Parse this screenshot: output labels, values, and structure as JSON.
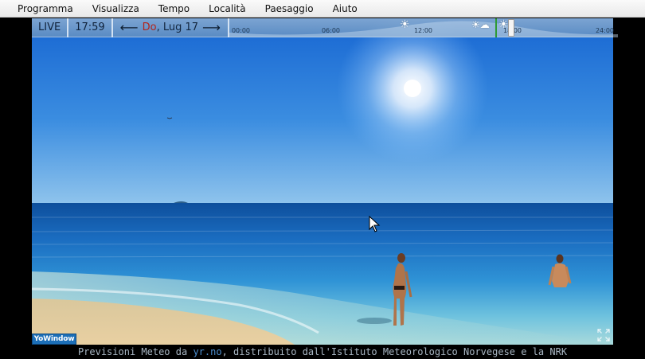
{
  "menu": {
    "items": [
      "Programma",
      "Visualizza",
      "Tempo",
      "Località",
      "Paesaggio",
      "Aiuto"
    ]
  },
  "toolbar": {
    "live_label": "LIVE",
    "time": "17:59",
    "prev_arrow": "⟵",
    "next_arrow": "⟶",
    "day_name": "Do",
    "date_rest": ", Lug 17",
    "day_color": "#b3241b"
  },
  "timeline": {
    "ticks": [
      "00:00",
      "06:00",
      "12:00",
      "18:00",
      "24:00"
    ],
    "icons": [
      "sun-icon",
      "sun-cloud-icon",
      "sun-icon"
    ]
  },
  "logo": {
    "text": "YoWindow"
  },
  "footer": {
    "prefix": "Previsioni Meteo da ",
    "link_text": "yr.no",
    "suffix": ", distribuito dall'Istituto Meteorologico Norvegese e la NRK"
  },
  "colors": {
    "sky_top": "#1b6fd6",
    "sky_horizon": "#8fc4ee",
    "sea": "#1a74c2",
    "sand": "#e8d3a8"
  }
}
